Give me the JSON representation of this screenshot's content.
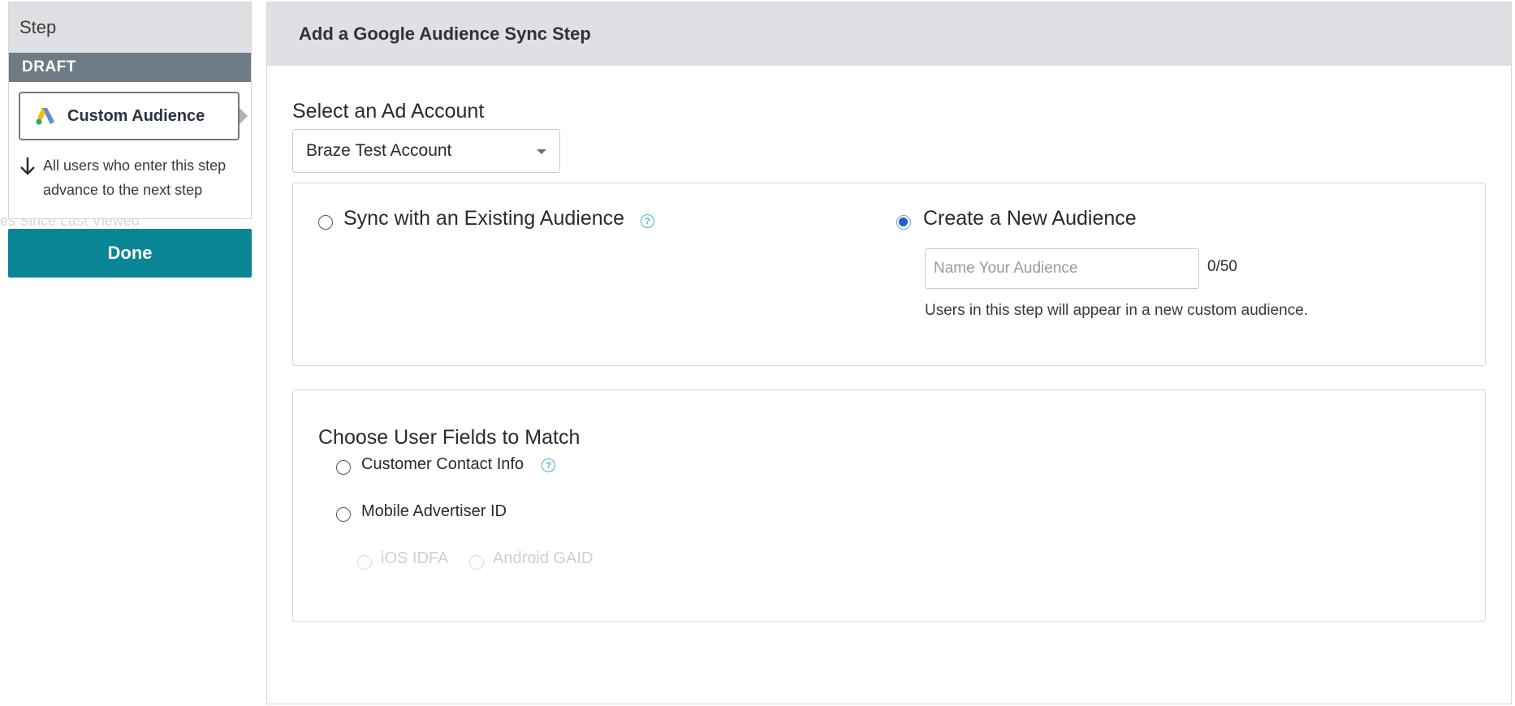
{
  "background": {
    "ghost_text": "es Since Last Viewed"
  },
  "left_panel": {
    "header": "Step",
    "status": "DRAFT",
    "step_card": {
      "name": "Custom Audience",
      "icon": "google-ads-icon"
    },
    "advance_note": "All users who enter this step advance to the next step",
    "done_label": "Done"
  },
  "main": {
    "title": "Add a Google Audience Sync Step",
    "ad_account": {
      "label": "Select an Ad Account",
      "selected": "Braze Test Account"
    },
    "audience_options": {
      "existing": {
        "label": "Sync with an Existing Audience",
        "selected": false
      },
      "new": {
        "label": "Create a New Audience",
        "selected": true,
        "input_placeholder": "Name Your Audience",
        "input_value": "",
        "char_count": "0/50",
        "hint": "Users in this step will appear in a new custom audience."
      }
    },
    "user_fields": {
      "label": "Choose User Fields to Match",
      "options": [
        {
          "label": "Customer Contact Info",
          "selected": false
        },
        {
          "label": "Mobile Advertiser ID",
          "selected": false
        }
      ],
      "sub_options": [
        {
          "label": "iOS IDFA",
          "disabled": true
        },
        {
          "label": "Android GAID",
          "disabled": true
        }
      ]
    }
  },
  "colors": {
    "accent_button": "#0a8596",
    "selected_radio": "#1a5fd8",
    "help_icon": "#41b6be",
    "draft_bar": "#6e7a84"
  }
}
